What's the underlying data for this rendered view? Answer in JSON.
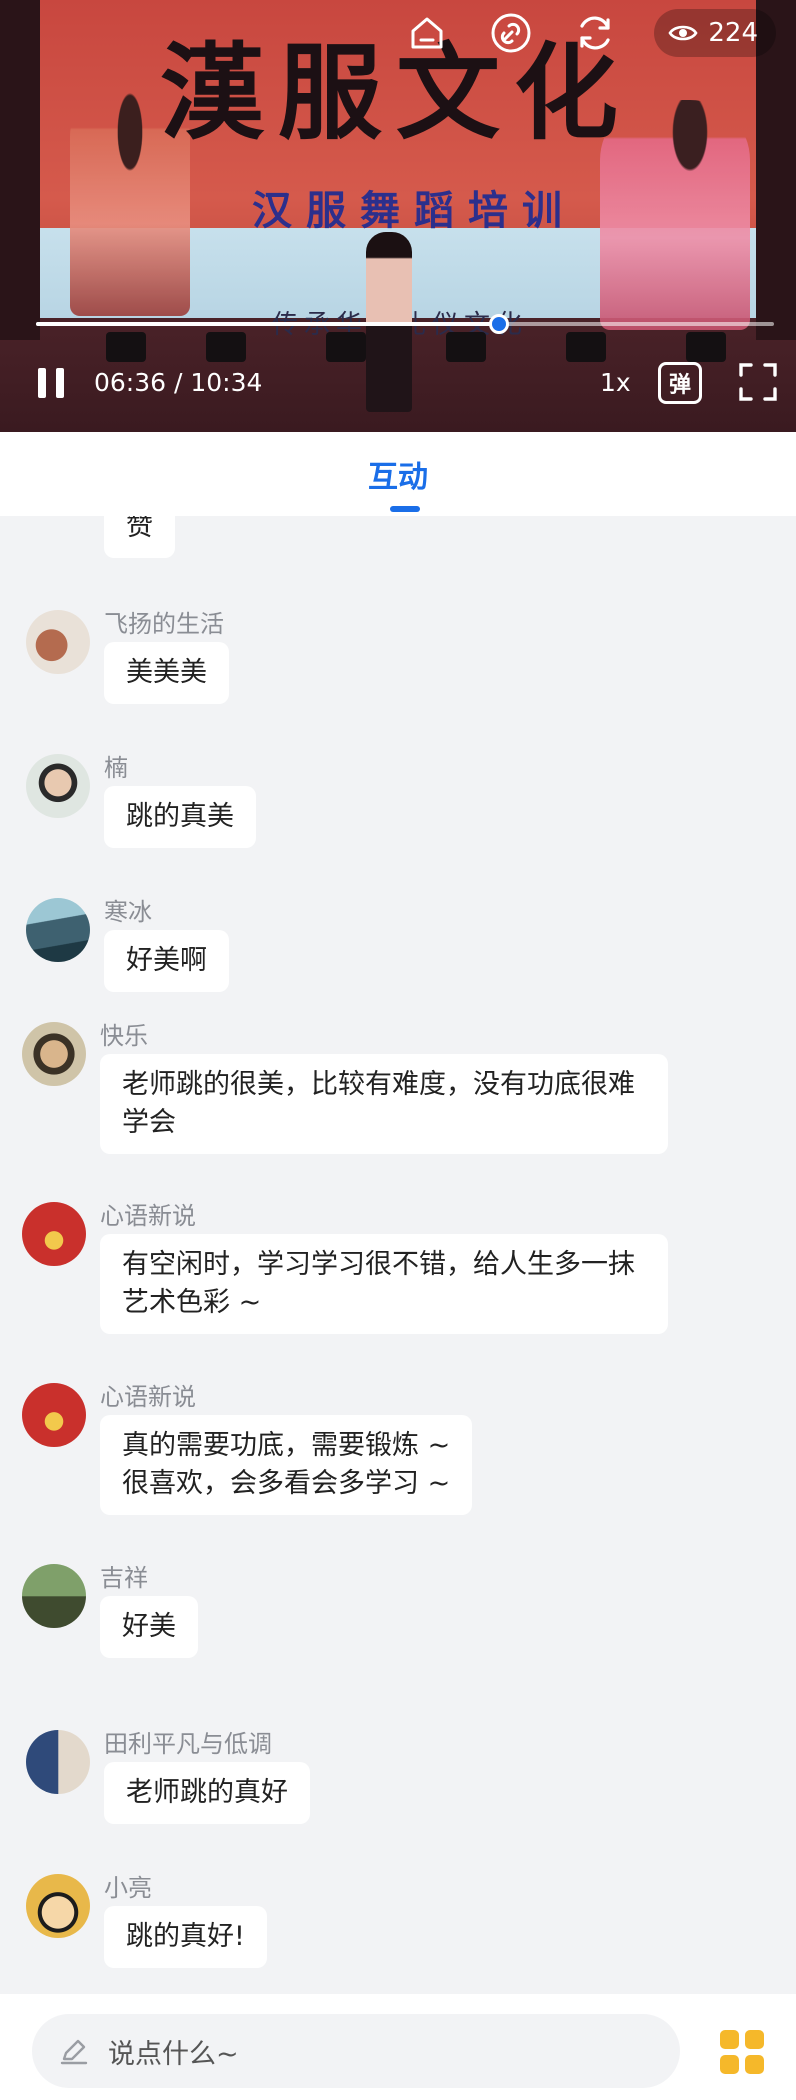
{
  "video": {
    "banner_title": "漢服文化",
    "banner_subtitle": "汉服舞蹈培训",
    "banner_motto": "传承华夏礼仪文化",
    "view_count": "224",
    "current_time": "06:36",
    "duration": "10:34",
    "time_display": "06:36 / 10:34",
    "progress": 0.628,
    "speed": "1x",
    "danmaku_label": "弹",
    "icons": [
      "home-icon",
      "link-icon",
      "refresh-icon",
      "eye-icon",
      "pause-icon",
      "danmaku-icon",
      "fullscreen-icon"
    ]
  },
  "tabs": {
    "active_label": "互动",
    "accent_color": "#1a6ee8"
  },
  "comments": [
    {
      "user": "",
      "text": "赞",
      "avatar_color": "#cfd3d8"
    },
    {
      "user": "飞扬的生活",
      "text": "美美美",
      "avatar_color": "#c9a08a"
    },
    {
      "user": "楠",
      "text": "跳的真美",
      "avatar_color": "#6e7c6a"
    },
    {
      "user": "寒冰",
      "text": "好美啊",
      "avatar_color": "#4b6f7d"
    },
    {
      "user": "快乐",
      "text": "老师跳的很美，比较有难度，没有功底很难学会",
      "avatar_color": "#7d6a50"
    },
    {
      "user": "心语新说",
      "text": "有空闲时，学习学习很不错，给人生多一抹艺术色彩 ~",
      "avatar_color": "#c9302c"
    },
    {
      "user": "心语新说",
      "text": "真的需要功底，需要锻炼 ~\n很喜欢，会多看会多学习 ~",
      "avatar_color": "#c9302c"
    },
    {
      "user": "吉祥",
      "text": "好美",
      "avatar_color": "#5b7b4a"
    },
    {
      "user": "田利平凡与低调",
      "text": "老师跳的真好",
      "avatar_color": "#3d5b8c"
    },
    {
      "user": "小亮",
      "text": "跳的真好!",
      "avatar_color": "#e8b84a"
    }
  ],
  "input": {
    "placeholder": "说点什么~",
    "icons": [
      "pencil-icon",
      "apps-grid-icon"
    ],
    "grid_color": "#f5b82a"
  }
}
